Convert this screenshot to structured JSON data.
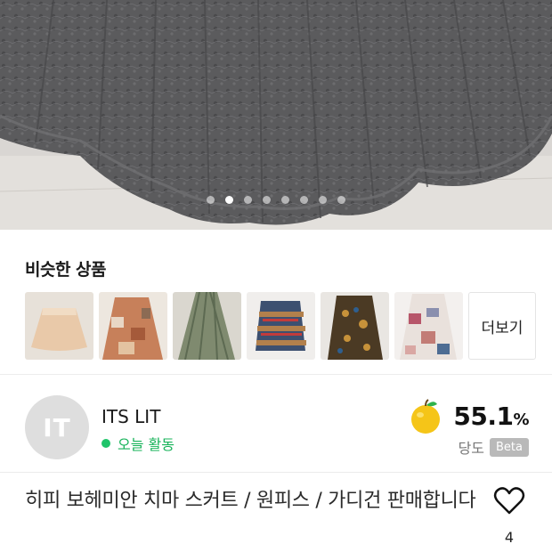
{
  "hero": {
    "image": "gray-lace-skirt-photo",
    "dots": [
      false,
      true,
      false,
      false,
      false,
      false,
      false,
      false
    ]
  },
  "similar": {
    "title": "비슷한 상품",
    "items": [
      "beige-skirt",
      "patchwork-skirt",
      "green-pleated-skirt",
      "blue-patterned-skirt",
      "brown-floral-skirt",
      "patchwork-lace-skirt"
    ],
    "more_label": "더보기"
  },
  "seller": {
    "avatar_initials": "IT",
    "name": "ITS LIT",
    "activity": "오늘 활동",
    "activity_color": "#17b35a",
    "sugar_score": "55.1",
    "sugar_unit": "%",
    "sugar_label": "당도",
    "beta_label": "Beta"
  },
  "product": {
    "title": "히피 보헤미안 치마 스커트 / 원피스 / 가디건 판매합니다",
    "like_count": "4"
  }
}
